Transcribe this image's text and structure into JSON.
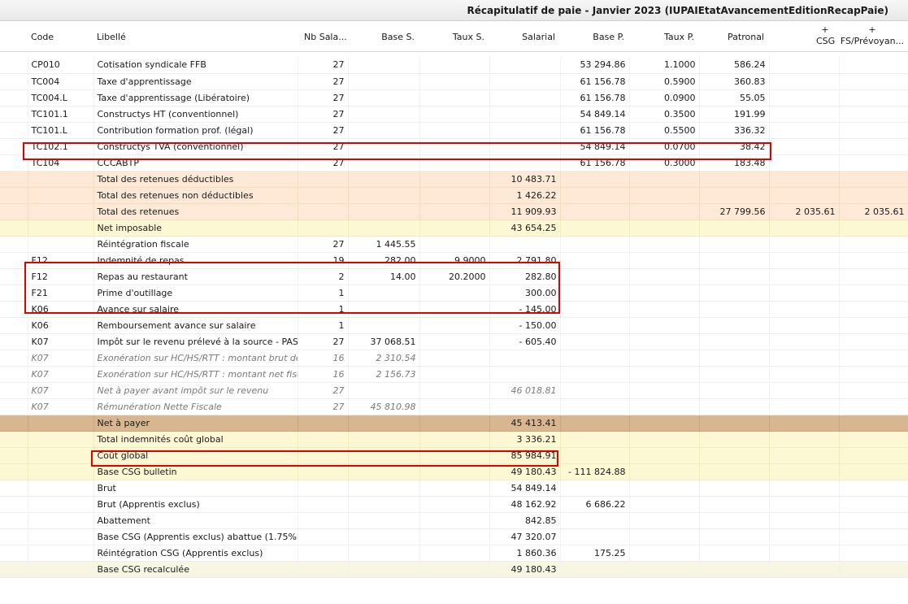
{
  "title": "Récapitulatif de paie - Janvier 2023 (IUPAIEtatAvancementEditionRecapPaie)",
  "columns": {
    "code": "Code",
    "libelle": "Libellé",
    "nb": "Nb Sala...",
    "base_s": "Base S.",
    "taux_s": "Taux S.",
    "salarial": "Salarial",
    "base_p": "Base P.",
    "taux_p": "Taux P.",
    "patronal": "Patronal",
    "csg_plus": "+",
    "csg": "CSG",
    "fs_plus": "+",
    "fs": "FS/Prévoyan..."
  },
  "rows": [
    {
      "style": "white",
      "code": "CP010",
      "libelle": "Cotisation syndicale FFB",
      "nb": "27",
      "base_s": "",
      "taux_s": "",
      "salarial": "",
      "base_p": "53 294.86",
      "taux_p": "1.1000",
      "patronal": "586.24",
      "csg": "",
      "fs": ""
    },
    {
      "style": "white",
      "code": "TC004",
      "libelle": "Taxe d'apprentissage",
      "nb": "27",
      "base_s": "",
      "taux_s": "",
      "salarial": "",
      "base_p": "61 156.78",
      "taux_p": "0.5900",
      "patronal": "360.83",
      "csg": "",
      "fs": ""
    },
    {
      "style": "white",
      "code": "TC004.L",
      "libelle": "Taxe d'apprentissage (Libératoire)",
      "nb": "27",
      "base_s": "",
      "taux_s": "",
      "salarial": "",
      "base_p": "61 156.78",
      "taux_p": "0.0900",
      "patronal": "55.05",
      "csg": "",
      "fs": ""
    },
    {
      "style": "white",
      "code": "TC101.1",
      "libelle": "Constructys HT (conventionnel)",
      "nb": "27",
      "base_s": "",
      "taux_s": "",
      "salarial": "",
      "base_p": "54 849.14",
      "taux_p": "0.3500",
      "patronal": "191.99",
      "csg": "",
      "fs": ""
    },
    {
      "style": "white",
      "code": "TC101.L",
      "libelle": "Contribution formation prof. (légal)",
      "nb": "27",
      "base_s": "",
      "taux_s": "",
      "salarial": "",
      "base_p": "61 156.78",
      "taux_p": "0.5500",
      "patronal": "336.32",
      "csg": "",
      "fs": ""
    },
    {
      "style": "white",
      "code": "TC102.1",
      "libelle": "Constructys TVA (conventionnel)",
      "nb": "27",
      "base_s": "",
      "taux_s": "",
      "salarial": "",
      "base_p": "54 849.14",
      "taux_p": "0.0700",
      "patronal": "38.42",
      "csg": "",
      "fs": ""
    },
    {
      "style": "white",
      "code": "TC104",
      "libelle": "CCCABTP",
      "nb": "27",
      "base_s": "",
      "taux_s": "",
      "salarial": "",
      "base_p": "61 156.78",
      "taux_p": "0.3000",
      "patronal": "183.48",
      "csg": "",
      "fs": ""
    },
    {
      "style": "orange",
      "code": "",
      "libelle": "Total des retenues déductibles",
      "nb": "",
      "base_s": "",
      "taux_s": "",
      "salarial": "10 483.71",
      "base_p": "",
      "taux_p": "",
      "patronal": "",
      "csg": "",
      "fs": ""
    },
    {
      "style": "orange",
      "code": "",
      "libelle": "Total des retenues non déductibles",
      "nb": "",
      "base_s": "",
      "taux_s": "",
      "salarial": "1 426.22",
      "base_p": "",
      "taux_p": "",
      "patronal": "",
      "csg": "",
      "fs": ""
    },
    {
      "style": "orange",
      "code": "",
      "libelle": "Total des retenues",
      "nb": "",
      "base_s": "",
      "taux_s": "",
      "salarial": "11 909.93",
      "base_p": "",
      "taux_p": "",
      "patronal": "27 799.56",
      "csg": "2 035.61",
      "fs": "2 035.61"
    },
    {
      "style": "yellow",
      "code": "",
      "libelle": "Net imposable",
      "nb": "",
      "base_s": "",
      "taux_s": "",
      "salarial": "43 654.25",
      "base_p": "",
      "taux_p": "",
      "patronal": "",
      "csg": "",
      "fs": ""
    },
    {
      "style": "white",
      "code": "",
      "libelle": "Réintégration fiscale",
      "nb": "27",
      "base_s": "1 445.55",
      "taux_s": "",
      "salarial": "",
      "base_p": "",
      "taux_p": "",
      "patronal": "",
      "csg": "",
      "fs": ""
    },
    {
      "style": "white",
      "code": "F12",
      "libelle": "Indemnité de repas",
      "nb": "19",
      "base_s": "282.00",
      "taux_s": "9.9000",
      "salarial": "2 791.80",
      "base_p": "",
      "taux_p": "",
      "patronal": "",
      "csg": "",
      "fs": ""
    },
    {
      "style": "white",
      "code": "F12",
      "libelle": "Repas au restaurant",
      "nb": "2",
      "base_s": "14.00",
      "taux_s": "20.2000",
      "salarial": "282.80",
      "base_p": "",
      "taux_p": "",
      "patronal": "",
      "csg": "",
      "fs": ""
    },
    {
      "style": "white",
      "code": "F21",
      "libelle": "Prime d'outillage",
      "nb": "1",
      "base_s": "",
      "taux_s": "",
      "salarial": "300.00",
      "base_p": "",
      "taux_p": "",
      "patronal": "",
      "csg": "",
      "fs": ""
    },
    {
      "style": "white",
      "code": "K06",
      "libelle": "Avance sur salaire",
      "nb": "1",
      "base_s": "",
      "taux_s": "",
      "salarial": "- 145.00",
      "base_p": "",
      "taux_p": "",
      "patronal": "",
      "csg": "",
      "fs": ""
    },
    {
      "style": "white",
      "code": "K06",
      "libelle": "Remboursement avance sur salaire",
      "nb": "1",
      "base_s": "",
      "taux_s": "",
      "salarial": "- 150.00",
      "base_p": "",
      "taux_p": "",
      "patronal": "",
      "csg": "",
      "fs": ""
    },
    {
      "style": "white",
      "code": "K07",
      "libelle": "Impôt sur le revenu prélevé à la source - PAS",
      "nb": "27",
      "base_s": "37 068.51",
      "taux_s": "",
      "salarial": "- 605.40",
      "base_p": "",
      "taux_p": "",
      "patronal": "",
      "csg": "",
      "fs": ""
    },
    {
      "style": "gray",
      "code": "K07",
      "libelle": "Exonération sur HC/HS/RTT : montant brut dé...",
      "nb": "16",
      "base_s": "2 310.54",
      "taux_s": "",
      "salarial": "",
      "base_p": "",
      "taux_p": "",
      "patronal": "",
      "csg": "",
      "fs": ""
    },
    {
      "style": "gray",
      "code": "K07",
      "libelle": "Exonération sur HC/HS/RTT : montant net fiscal",
      "nb": "16",
      "base_s": "2 156.73",
      "taux_s": "",
      "salarial": "",
      "base_p": "",
      "taux_p": "",
      "patronal": "",
      "csg": "",
      "fs": ""
    },
    {
      "style": "gray",
      "code": "K07",
      "libelle": "Net à payer avant impôt sur le revenu",
      "nb": "27",
      "base_s": "",
      "taux_s": "",
      "salarial": "46 018.81",
      "base_p": "",
      "taux_p": "",
      "patronal": "",
      "csg": "",
      "fs": ""
    },
    {
      "style": "gray",
      "code": "K07",
      "libelle": "Rémunération Nette Fiscale",
      "nb": "27",
      "base_s": "45 810.98",
      "taux_s": "",
      "salarial": "",
      "base_p": "",
      "taux_p": "",
      "patronal": "",
      "csg": "",
      "fs": ""
    },
    {
      "style": "brown",
      "code": "",
      "libelle": "Net à payer",
      "nb": "",
      "base_s": "",
      "taux_s": "",
      "salarial": "45 413.41",
      "base_p": "",
      "taux_p": "",
      "patronal": "",
      "csg": "",
      "fs": ""
    },
    {
      "style": "yellow",
      "code": "",
      "libelle": "Total indemnités coût global",
      "nb": "",
      "base_s": "",
      "taux_s": "",
      "salarial": "3 336.21",
      "base_p": "",
      "taux_p": "",
      "patronal": "",
      "csg": "",
      "fs": ""
    },
    {
      "style": "yellow",
      "code": "",
      "libelle": "Coût global",
      "nb": "",
      "base_s": "",
      "taux_s": "",
      "salarial": "85 984.91",
      "base_p": "",
      "taux_p": "",
      "patronal": "",
      "csg": "",
      "fs": ""
    },
    {
      "style": "yellow",
      "code": "",
      "libelle": "Base CSG bulletin",
      "nb": "",
      "base_s": "",
      "taux_s": "",
      "salarial": "49 180.43",
      "base_p": "- 111 824.88",
      "taux_p": "",
      "patronal": "",
      "csg": "",
      "fs": ""
    },
    {
      "style": "white",
      "code": "",
      "libelle": "Brut",
      "nb": "",
      "base_s": "",
      "taux_s": "",
      "salarial": "54 849.14",
      "base_p": "",
      "taux_p": "",
      "patronal": "",
      "csg": "",
      "fs": ""
    },
    {
      "style": "white",
      "code": "",
      "libelle": "Brut (Apprentis exclus)",
      "nb": "",
      "base_s": "",
      "taux_s": "",
      "salarial": "48 162.92",
      "base_p": "6 686.22",
      "taux_p": "",
      "patronal": "",
      "csg": "",
      "fs": ""
    },
    {
      "style": "white",
      "code": "",
      "libelle": "Abattement",
      "nb": "",
      "base_s": "",
      "taux_s": "",
      "salarial": "842.85",
      "base_p": "",
      "taux_p": "",
      "patronal": "",
      "csg": "",
      "fs": ""
    },
    {
      "style": "white",
      "code": "",
      "libelle": "Base CSG (Apprentis exclus) abattue (1.75%)",
      "nb": "",
      "base_s": "",
      "taux_s": "",
      "salarial": "47 320.07",
      "base_p": "",
      "taux_p": "",
      "patronal": "",
      "csg": "",
      "fs": ""
    },
    {
      "style": "white",
      "code": "",
      "libelle": "Réintégration CSG (Apprentis exclus)",
      "nb": "",
      "base_s": "",
      "taux_s": "",
      "salarial": "1 860.36",
      "base_p": "175.25",
      "taux_p": "",
      "patronal": "",
      "csg": "",
      "fs": ""
    },
    {
      "style": "lightgreen",
      "code": "",
      "libelle": "Base CSG recalculée",
      "nb": "",
      "base_s": "",
      "taux_s": "",
      "salarial": "49 180.43",
      "base_p": "",
      "taux_p": "",
      "patronal": "",
      "csg": "",
      "fs": ""
    }
  ],
  "colors": {
    "highlight": "#e00000",
    "orange": "#fde9d6",
    "yellow": "#fdf8d4",
    "brown": "#d8b790"
  }
}
